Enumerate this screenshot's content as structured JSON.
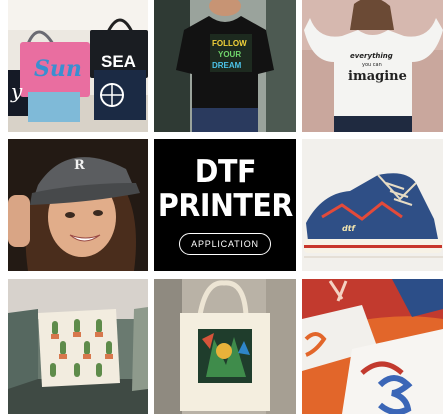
{
  "center_tile": {
    "headline_line1": "DTF",
    "headline_line2": "PRINTER",
    "button_label": "APPLICATION"
  },
  "printed_designs": {
    "bag_text": "SEA",
    "bag_script": "Sun",
    "bag_letter": "y",
    "cap_letter": "R",
    "tee_lines": [
      "FOLLOW",
      "YOUR",
      "DREAM"
    ],
    "sweater_lines": [
      "everything",
      "you can",
      "imagine"
    ],
    "shoe_logo": "dtf"
  },
  "colors": {
    "center_background": "#000000",
    "center_text": "#ffffff",
    "shoe_blue": "#2f4f86",
    "jersey_orange": "#e2662a"
  }
}
